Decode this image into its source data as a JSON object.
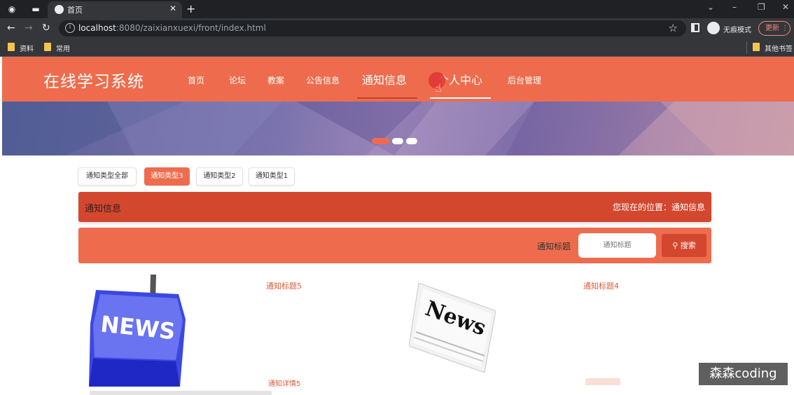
{
  "browser": {
    "tab_title": "首页",
    "url_host": "localhost",
    "url_rest": ":8080/zaixianxuexi/front/index.html",
    "incognito_label": "无痕模式",
    "update_label": "更新",
    "bookmarks": [
      "资料",
      "常用"
    ],
    "other_bookmarks": "其他书签"
  },
  "site": {
    "logo": "在线学习系统",
    "nav": [
      "首页",
      "论坛",
      "教案",
      "公告信息",
      "通知信息",
      "个人中心",
      "后台管理"
    ]
  },
  "filters": [
    "通知类型全部",
    "通知类型3",
    "通知类型2",
    "通知类型1"
  ],
  "active_filter": "通知类型3",
  "breadcrumb": {
    "title": "通知信息",
    "location": "您现在的位置：通知信息"
  },
  "search": {
    "label": "通知标题",
    "placeholder": "通知标题",
    "button": "搜索"
  },
  "items": [
    {
      "title": "通知标题5",
      "detail": "通知详情5",
      "image_text": "NEWS"
    },
    {
      "title": "通知标题4",
      "image_text": "News"
    }
  ],
  "watermark": "森森coding",
  "colors": {
    "primary": "#ee6c4d",
    "dark": "#d4472f"
  }
}
